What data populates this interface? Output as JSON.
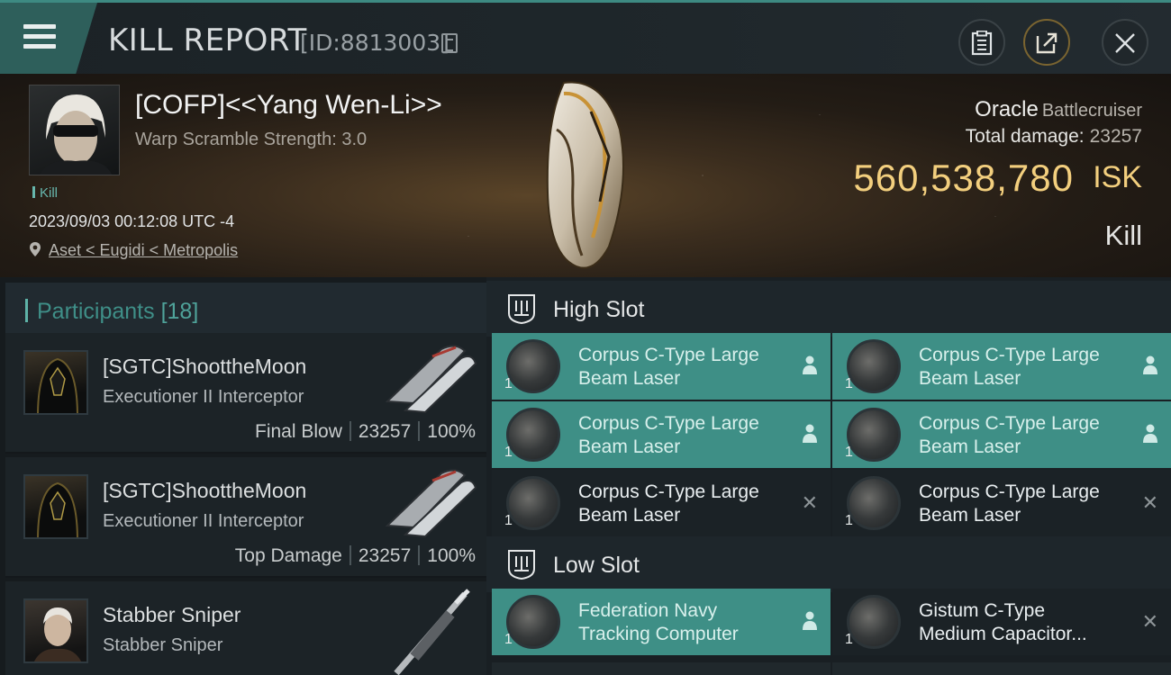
{
  "header": {
    "title": "KILL REPORT",
    "report_id": "[ID:8813003]",
    "icons": [
      "menu-icon",
      "copy-icon",
      "clipboard-icon",
      "share-icon",
      "close-icon"
    ]
  },
  "victim": {
    "pilot": "[COFP]<<Yang Wen-Li>>",
    "scramble": "Warp Scramble Strength: 3.0",
    "tag": "Kill",
    "timestamp": "2023/09/03 00:12:08 UTC -4",
    "location": "Aset < Eugidi < Metropolis",
    "ship_name": "Oracle",
    "ship_class": "Battlecruiser",
    "total_damage_label": "Total damage:",
    "total_damage_value": "23257",
    "isk_value": "560,538,780",
    "isk_unit": "ISK",
    "result": "Kill"
  },
  "participants": {
    "label": "Participants",
    "count": "[18]",
    "list": [
      {
        "name": "[SGTC]ShoottheMoon",
        "ship": "Executioner II Interceptor",
        "role": "Final Blow",
        "damage": "23257",
        "percent": "100%"
      },
      {
        "name": "[SGTC]ShoottheMoon",
        "ship": "Executioner II Interceptor",
        "role": "Top Damage",
        "damage": "23257",
        "percent": "100%"
      },
      {
        "name": "Stabber Sniper",
        "ship": "Stabber Sniper",
        "role": "",
        "damage": "",
        "percent": ""
      }
    ]
  },
  "slots": {
    "high": {
      "label": "High Slot",
      "modules": [
        {
          "line1": "Corpus C-Type Large",
          "line2": "Beam Laser",
          "qty": "1",
          "status": "fitted"
        },
        {
          "line1": "Corpus C-Type Large",
          "line2": "Beam Laser",
          "qty": "1",
          "status": "fitted"
        },
        {
          "line1": "Corpus C-Type Large",
          "line2": "Beam Laser",
          "qty": "1",
          "status": "fitted"
        },
        {
          "line1": "Corpus C-Type Large",
          "line2": "Beam Laser",
          "qty": "1",
          "status": "fitted"
        },
        {
          "line1": "Corpus C-Type Large",
          "line2": "Beam Laser",
          "qty": "1",
          "status": "destroyed"
        },
        {
          "line1": "Corpus C-Type Large",
          "line2": "Beam Laser",
          "qty": "1",
          "status": "destroyed"
        }
      ]
    },
    "low": {
      "label": "Low Slot",
      "modules": [
        {
          "line1": "Federation Navy",
          "line2": "Tracking Computer",
          "qty": "1",
          "status": "fitted"
        },
        {
          "line1": "Gistum C-Type",
          "line2": "Medium Capacitor...",
          "qty": "1",
          "status": "destroyed"
        }
      ]
    }
  },
  "colors": {
    "accent": "#3e8f86",
    "isk": "#f3cf7e",
    "participants_label": "#3f8f88"
  }
}
